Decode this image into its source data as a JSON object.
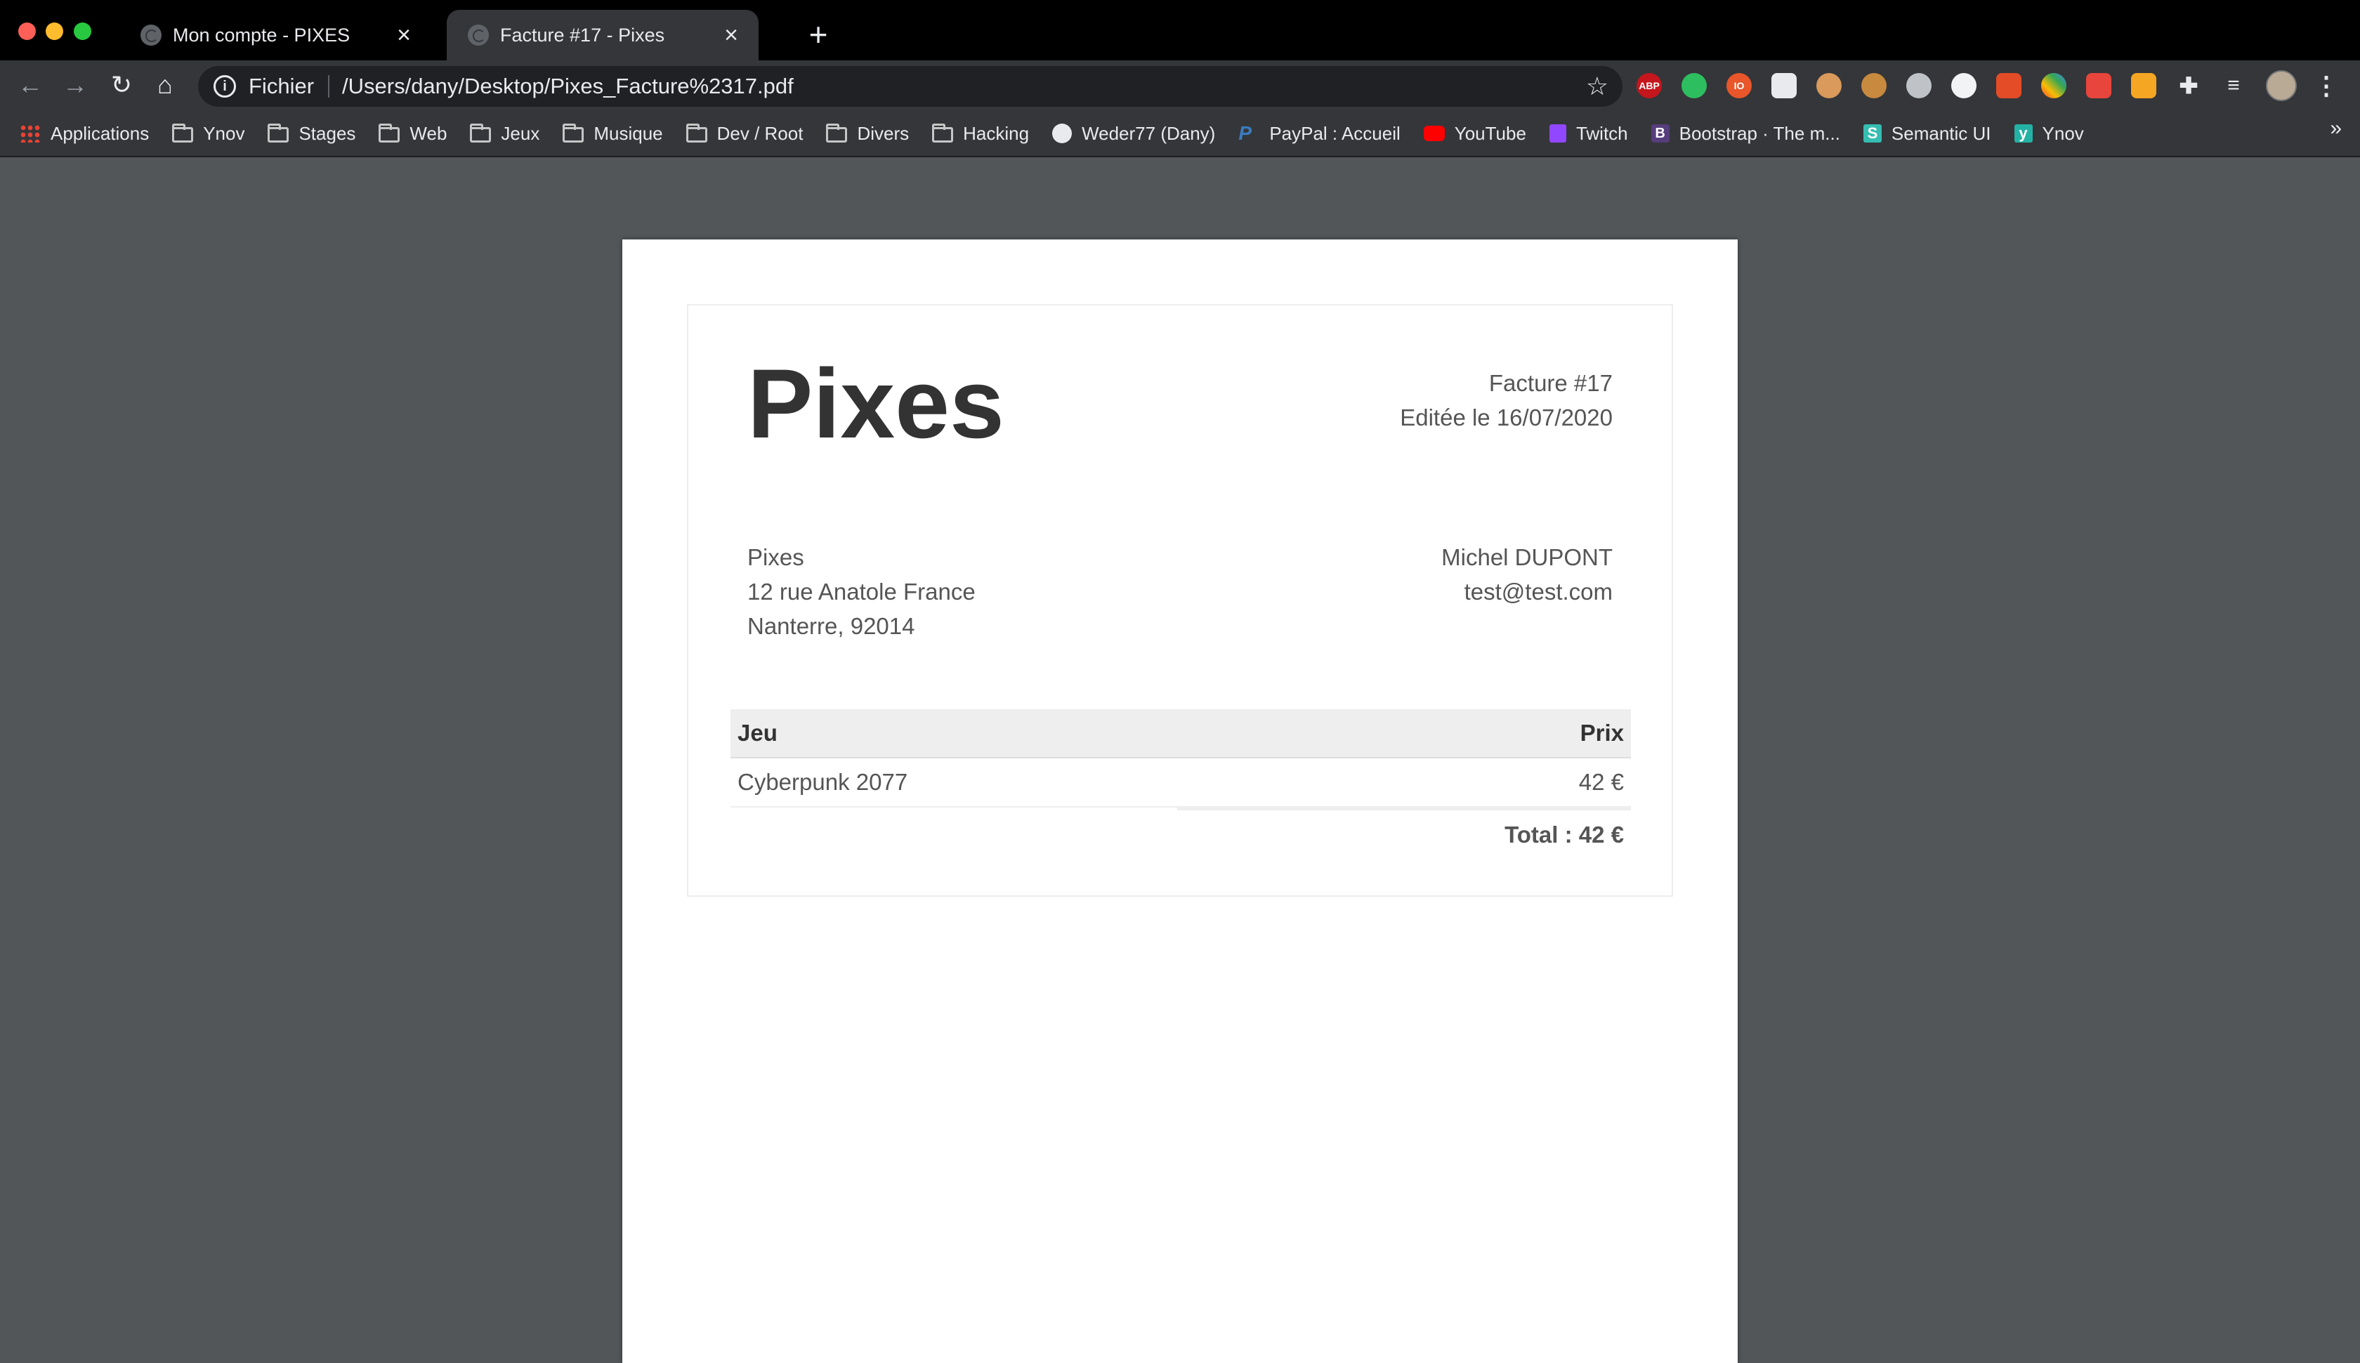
{
  "browser": {
    "tabs": [
      {
        "title": "Mon compte - PIXES",
        "active": false
      },
      {
        "title": "Facture #17 - Pixes",
        "active": true
      }
    ],
    "address": {
      "scheme_label": "Fichier",
      "url": "/Users/dany/Desktop/Pixes_Facture%2317.pdf"
    },
    "extensions": [
      "ABP",
      "evernote",
      "io",
      "sheet",
      "brain",
      "cookie",
      "gear",
      "ball",
      "bars",
      "palette",
      "fire",
      "grid",
      "puzzle",
      "media"
    ],
    "bookmarks": [
      {
        "label": "Applications",
        "icon": "apps-icon"
      },
      {
        "label": "Ynov",
        "icon": "folder-icon"
      },
      {
        "label": "Stages",
        "icon": "folder-icon"
      },
      {
        "label": "Web",
        "icon": "folder-icon"
      },
      {
        "label": "Jeux",
        "icon": "folder-icon"
      },
      {
        "label": "Musique",
        "icon": "folder-icon"
      },
      {
        "label": "Dev / Root",
        "icon": "folder-icon"
      },
      {
        "label": "Divers",
        "icon": "folder-icon"
      },
      {
        "label": "Hacking",
        "icon": "folder-icon"
      },
      {
        "label": "Weder77 (Dany)",
        "icon": "github-icon"
      },
      {
        "label": "PayPal : Accueil",
        "icon": "paypal-icon"
      },
      {
        "label": "YouTube",
        "icon": "youtube-icon"
      },
      {
        "label": "Twitch",
        "icon": "twitch-icon"
      },
      {
        "label": "Bootstrap · The m...",
        "icon": "bootstrap-icon"
      },
      {
        "label": "Semantic UI",
        "icon": "semantic-ui-icon"
      },
      {
        "label": "Ynov",
        "icon": "ynov-icon"
      }
    ],
    "overflow_label": "»"
  },
  "invoice": {
    "brand": "Pixes",
    "number": "Facture #17",
    "date": "Editée le 16/07/2020",
    "seller": {
      "name": "Pixes",
      "street": "12 rue Anatole France",
      "city": "Nanterre, 92014"
    },
    "customer": {
      "name": "Michel DUPONT",
      "email": "test@test.com"
    },
    "table": {
      "col_game": "Jeu",
      "col_price": "Prix",
      "rows": [
        {
          "game": "Cyberpunk 2077",
          "price": "42 €"
        }
      ],
      "total": "Total : 42 €"
    }
  },
  "colors": {
    "viewer_bg": "#525659",
    "toolbar_bg": "#35363a",
    "tabstrip_bg": "#000000"
  }
}
